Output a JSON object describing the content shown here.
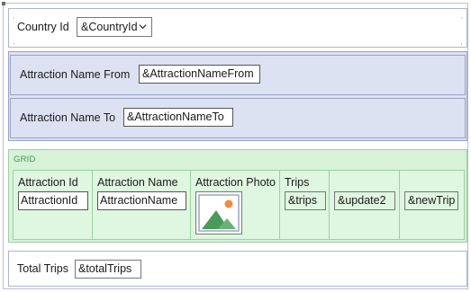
{
  "header": {
    "country_label": "Country Id",
    "country_value": "&CountryId"
  },
  "filters": {
    "from_label": "Attraction Name From",
    "from_value": "&AttractionNameFrom",
    "to_label": "Attraction Name To",
    "to_value": "&AttractionNameTo"
  },
  "grid": {
    "title": "GRID",
    "columns": [
      {
        "header": "Attraction Id",
        "value": "AttractionId"
      },
      {
        "header": "Attraction Name",
        "value": "AttractionName"
      },
      {
        "header": "Attraction Photo",
        "value": ""
      },
      {
        "header": "Trips",
        "value": "&trips"
      },
      {
        "header": "",
        "value": "&update2"
      },
      {
        "header": "",
        "value": "&newTrip"
      }
    ],
    "photo_icon": "image-placeholder-icon"
  },
  "footer": {
    "total_label": "Total Trips",
    "total_value": "&totalTrips"
  },
  "colors": {
    "blue_section": "#dde2f2",
    "grid_green": "#d7f2d8",
    "grid_title": "#3c9a4a",
    "photo_mountain": "#4a9a5a",
    "photo_sun": "#f28a3c"
  }
}
